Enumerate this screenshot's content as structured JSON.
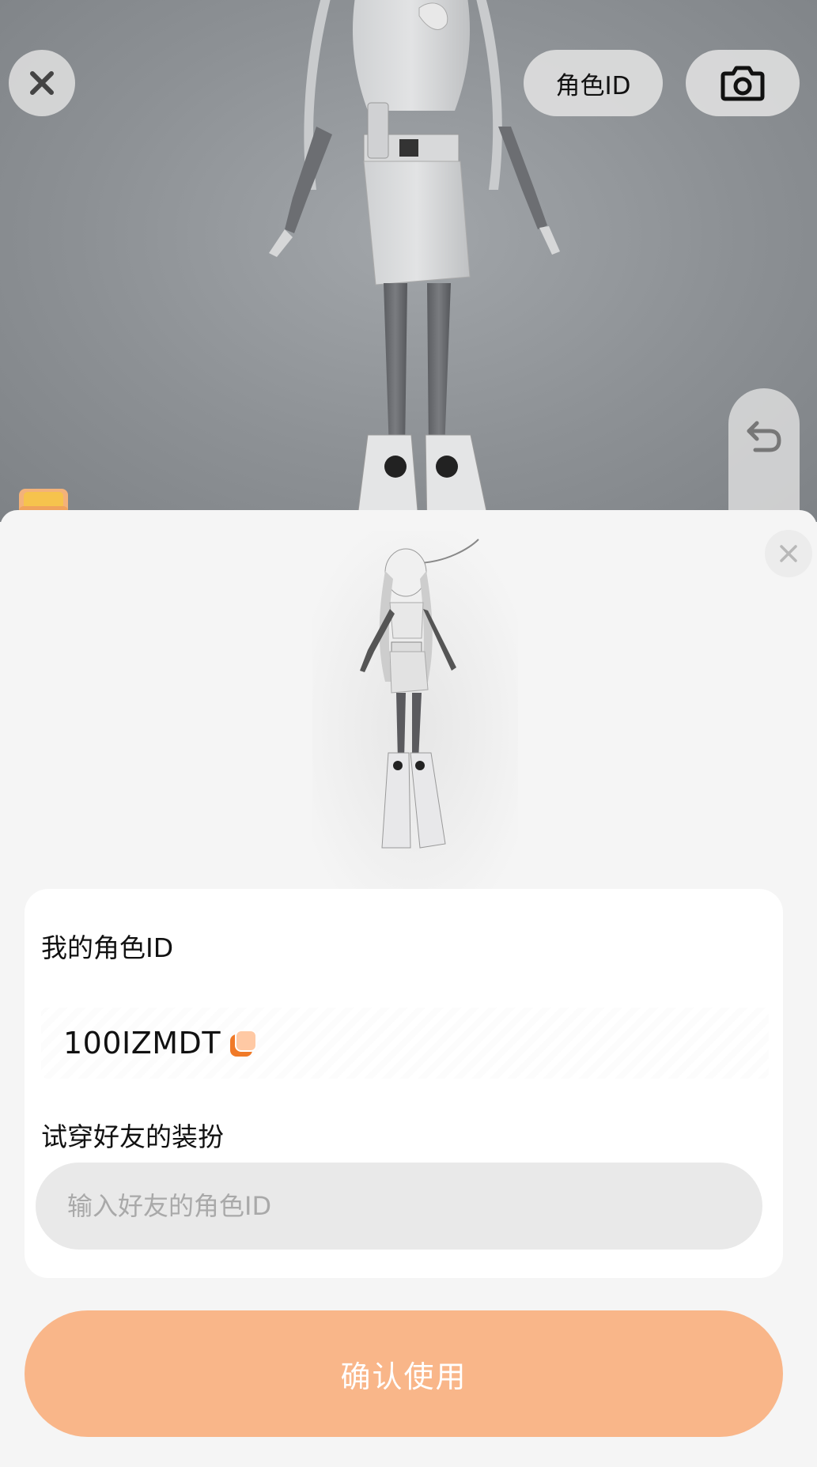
{
  "toolbar": {
    "close_icon": "close-icon",
    "role_id_label": "角色ID",
    "camera_icon": "camera-icon",
    "undo_icon": "undo-icon"
  },
  "sheet": {
    "close_icon": "close-icon",
    "my_role_id_label": "我的角色ID",
    "my_role_id_value": "100IZMDT",
    "copy_icon": "copy-icon",
    "try_friend_label": "试穿好友的装扮",
    "friend_input_placeholder": "输入好友的角色ID",
    "friend_input_value": "",
    "confirm_label": "确认使用"
  },
  "colors": {
    "accent": "#f9b689",
    "accent_dark": "#f07a28",
    "viewport_bg": "#8d9195",
    "sheet_bg": "#f5f5f5"
  }
}
